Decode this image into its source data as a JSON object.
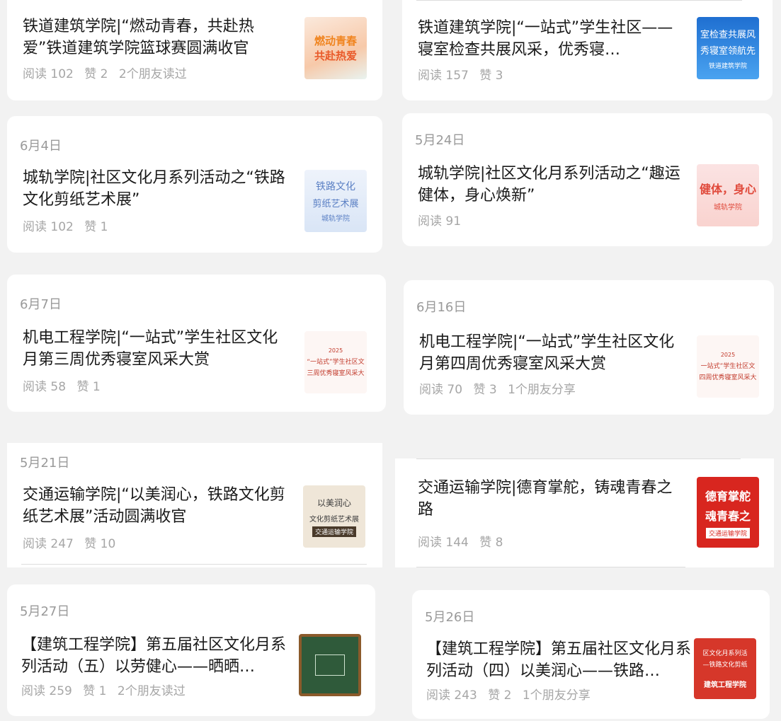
{
  "articles": [
    {
      "title": "铁道建筑学院|“燃动青春，共赴热爱”铁道建筑学院篮球赛圆满收官",
      "read": "阅读 102",
      "likes": "赞 2",
      "extra": "2个朋友读过",
      "thumb": {
        "line1": "燃动青春",
        "line2": "共赴热爱",
        "line3": ""
      }
    },
    {
      "title": "铁道建筑学院|“一站式”学生社区——寝室检查共展风采，优秀寝…",
      "read": "阅读 157",
      "likes": "赞 3",
      "extra": "",
      "thumb": {
        "line1": "室检查共展风",
        "line2": "秀寝室领航先",
        "line3": "铁道建筑学院"
      }
    },
    {
      "date": "6月4日",
      "title": "城轨学院|社区文化月系列活动之“铁路文化剪纸艺术展”",
      "read": "阅读 102",
      "likes": "赞 1",
      "extra": "",
      "thumb": {
        "line1": "铁路文化",
        "line2": "剪纸艺术展",
        "line3": "城轨学院"
      }
    },
    {
      "date": "5月24日",
      "title": "城轨学院|社区文化月系列活动之“趣运健体，身心焕新”",
      "read": "阅读 91",
      "likes": "",
      "extra": "",
      "thumb": {
        "line1": "健体，身心",
        "line2": "城轨学院",
        "line3": ""
      }
    },
    {
      "date": "6月7日",
      "title": "机电工程学院|“一站式”学生社区文化月第三周优秀寝室风采大赏",
      "read": "阅读 58",
      "likes": "赞 1",
      "extra": "",
      "thumb": {
        "line1": "2025",
        "line2": "“一站式”学生社区文",
        "line3": "三周优秀寝室风采大"
      }
    },
    {
      "date": "6月16日",
      "title": "机电工程学院|“一站式”学生社区文化月第四周优秀寝室风采大赏",
      "read": "阅读 70",
      "likes": "赞 3",
      "extra": "1个朋友分享",
      "thumb": {
        "line1": "2025",
        "line2": "一站式”学生社区文",
        "line3": "四周优秀寝室风采大"
      }
    },
    {
      "date": "5月21日",
      "title": "交通运输学院|“以美润心，铁路文化剪纸艺术展”活动圆满收官",
      "read": "阅读 247",
      "likes": "赞 10",
      "extra": "",
      "thumb": {
        "line1": "以美润心",
        "line2": "文化剪纸艺术展",
        "line3": "交通运输学院"
      }
    },
    {
      "title": "交通运输学院|德育掌舵，铸魂青春之路",
      "read": "阅读 144",
      "likes": "赞 8",
      "extra": "",
      "thumb": {
        "line1": "德育掌舵",
        "line2": "魂青春之",
        "line3": "交通运输学院"
      }
    },
    {
      "date": "5月27日",
      "title": "【建筑工程学院】第五届社区文化月系列活动（五）以劳健心——晒晒…",
      "read": "阅读 259",
      "likes": "赞 1",
      "extra": "2个朋友读过",
      "thumb": {
        "line1": "",
        "line2": "",
        "line3": ""
      }
    },
    {
      "date": "5月26日",
      "title": "【建筑工程学院】第五届社区文化月系列活动（四）以美润心——铁路…",
      "read": "阅读 243",
      "likes": "赞 2",
      "extra": "1个朋友分享",
      "thumb": {
        "line1": "区文化月系列活",
        "line2": "—铁路文化剪纸",
        "line3": "建筑工程学院"
      }
    }
  ]
}
